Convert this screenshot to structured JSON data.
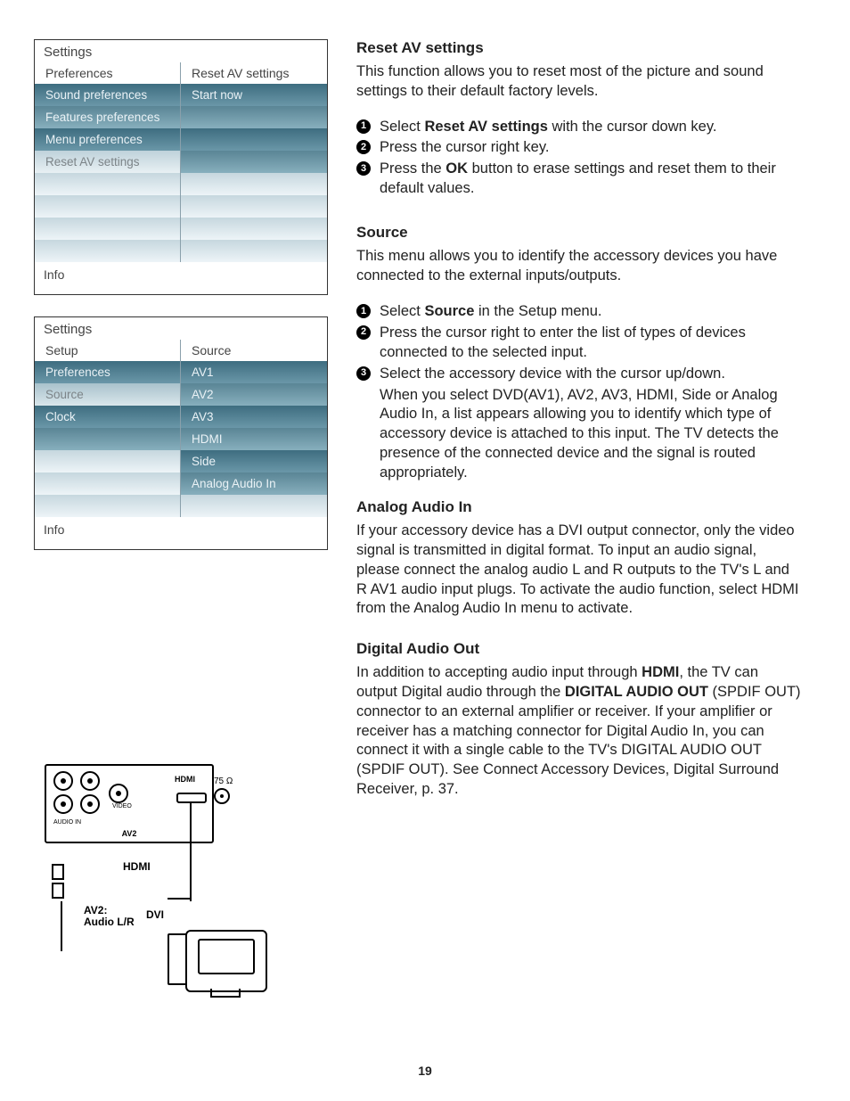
{
  "page_number": "19",
  "menus": {
    "reset": {
      "title": "Settings",
      "left_header": "Preferences",
      "right_header": "Reset AV settings",
      "left_items": [
        "Sound preferences",
        "Features preferences",
        "Menu preferences",
        "Reset AV settings"
      ],
      "right_items": [
        "Start now"
      ],
      "info": "Info"
    },
    "source": {
      "title": "Settings",
      "left_header": "Setup",
      "right_header": "Source",
      "left_items": [
        "Preferences",
        "Source",
        "Clock"
      ],
      "right_items": [
        "AV1",
        "AV2",
        "AV3",
        "HDMI",
        "Side",
        "Analog Audio In"
      ],
      "info": "Info"
    }
  },
  "diagram": {
    "av2": "AV2",
    "video": "VIDEO",
    "audio_in": "AUDIO IN",
    "hdmi": "HDMI",
    "ohm": "75 Ω",
    "dvi": "DVI",
    "av2_audio": "AV2:\nAudio L/R"
  },
  "sections": {
    "reset": {
      "heading": "Reset AV settings",
      "intro": "This function allows you to reset most of the picture and sound settings to their default factory levels.",
      "steps": [
        {
          "pre": "Select ",
          "bold": "Reset AV settings",
          "post": " with the cursor down key."
        },
        {
          "pre": "Press the cursor right key.",
          "bold": "",
          "post": ""
        },
        {
          "pre": "Press the ",
          "bold": "OK",
          "post": " button to erase settings and reset them to their default values."
        }
      ]
    },
    "source": {
      "heading": "Source",
      "intro": "This menu allows you to identify the accessory devices you have connected to the external inputs/outputs.",
      "steps": [
        {
          "pre": "Select ",
          "bold": "Source",
          "post": " in the Setup menu."
        },
        {
          "pre": "Press the cursor right to enter the list of types of devices connected to the selected input.",
          "bold": "",
          "post": ""
        },
        {
          "pre": "Select the accessory device with the cursor up/down.",
          "bold": "",
          "post": ""
        }
      ],
      "extra": "When you select DVD(AV1), AV2, AV3, HDMI, Side or Analog Audio In, a list appears allowing you to identify which type of accessory device is attached to this input. The TV detects the presence of the connected device and the signal is routed appropriately."
    },
    "analog": {
      "heading": "Analog Audio In",
      "body": "If your accessory device has a DVI output connector, only the video signal is transmitted in digital format.  To input an audio signal, please connect the analog audio L and R outputs to the TV's L and R AV1 audio input plugs.  To activate the audio function, select  HDMI from the Analog Audio In menu to activate."
    },
    "digital": {
      "heading": "Digital Audio Out",
      "pre": "In addition to accepting audio input through ",
      "b1": "HDMI",
      "mid": ", the TV can output Digital audio through the ",
      "b2": "DIGITAL AUDIO OUT",
      "post": " (SPDIF OUT) connector to an external amplifier or receiver. If your amplifier or receiver has a matching connector for Digital Audio In, you can connect it with a single cable to the TV's DIGITAL AUDIO OUT (SPDIF OUT). See Connect Accessory Devices, Digital Surround Receiver, p. 37."
    }
  }
}
